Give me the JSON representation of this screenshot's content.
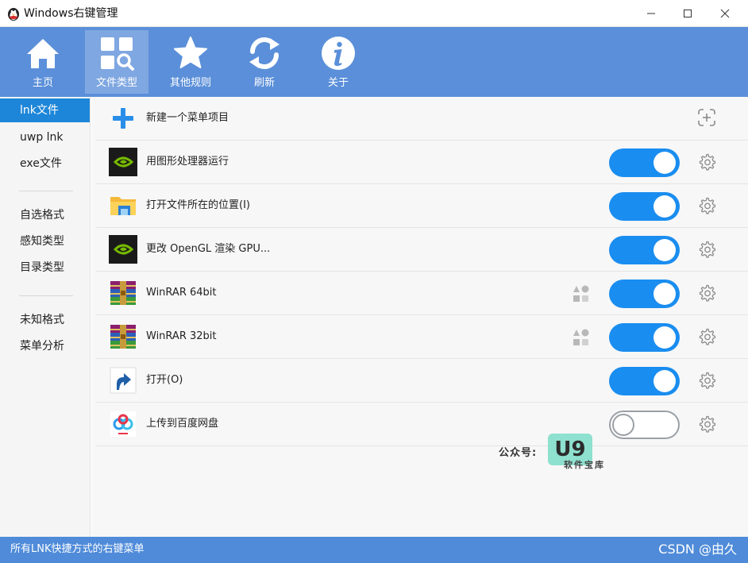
{
  "window": {
    "title": "Windows右键管理",
    "icon": "penguin-app-icon",
    "controls": [
      "minimize-icon",
      "maximize-icon",
      "close-icon"
    ]
  },
  "toolbar": {
    "items": [
      {
        "label": "主页",
        "icon": "home-icon",
        "active": false
      },
      {
        "label": "文件类型",
        "icon": "file-type-search-icon",
        "active": true
      },
      {
        "label": "其他规则",
        "icon": "star-icon",
        "active": false
      },
      {
        "label": "刷新",
        "icon": "refresh-icon",
        "active": false
      },
      {
        "label": "关于",
        "icon": "info-icon",
        "active": false
      }
    ],
    "background": "#5b8fd9"
  },
  "sidebar": {
    "groups": [
      [
        {
          "label": "lnk文件",
          "active": true
        },
        {
          "label": "uwp lnk",
          "active": false
        },
        {
          "label": "exe文件",
          "active": false
        }
      ],
      [
        {
          "label": "自选格式",
          "active": false
        },
        {
          "label": "感知类型",
          "active": false
        },
        {
          "label": "目录类型",
          "active": false
        }
      ],
      [
        {
          "label": "未知格式",
          "active": false
        },
        {
          "label": "菜单分析",
          "active": false
        }
      ]
    ],
    "active_color": "#1e86d8"
  },
  "list": {
    "new_item": {
      "label": "新建一个菜单项目",
      "icon": "plus-icon",
      "action_icon": "add-circle-icon"
    },
    "items": [
      {
        "label": "用图形处理器运行",
        "icon": "nvidia-icon",
        "enabled": true,
        "extra_icon": null
      },
      {
        "label": "打开文件所在的位置(I)",
        "icon": "folder-icon",
        "enabled": true,
        "extra_icon": null
      },
      {
        "label": "更改 OpenGL 渲染 GPU...",
        "icon": "nvidia-icon",
        "enabled": true,
        "extra_icon": null
      },
      {
        "label": "WinRAR 64bit",
        "icon": "winrar-icon",
        "enabled": true,
        "extra_icon": "shapes-icon"
      },
      {
        "label": "WinRAR 32bit",
        "icon": "winrar-icon",
        "enabled": true,
        "extra_icon": "shapes-icon"
      },
      {
        "label": "打开(O)",
        "icon": "shortcut-arrow-icon",
        "enabled": true,
        "extra_icon": null
      },
      {
        "label": "上传到百度网盘",
        "icon": "baidu-netdisk-icon",
        "enabled": false,
        "extra_icon": null
      }
    ],
    "toggle_on_color": "#1a8df0",
    "toggle_off_color": "#9aa0a6"
  },
  "watermark": {
    "label": "公众号:",
    "logo": "U9",
    "sub": "软件宝库"
  },
  "statusbar": {
    "text": "所有LNK快捷方式的右键菜单",
    "right_text": "CSDN @由久"
  }
}
